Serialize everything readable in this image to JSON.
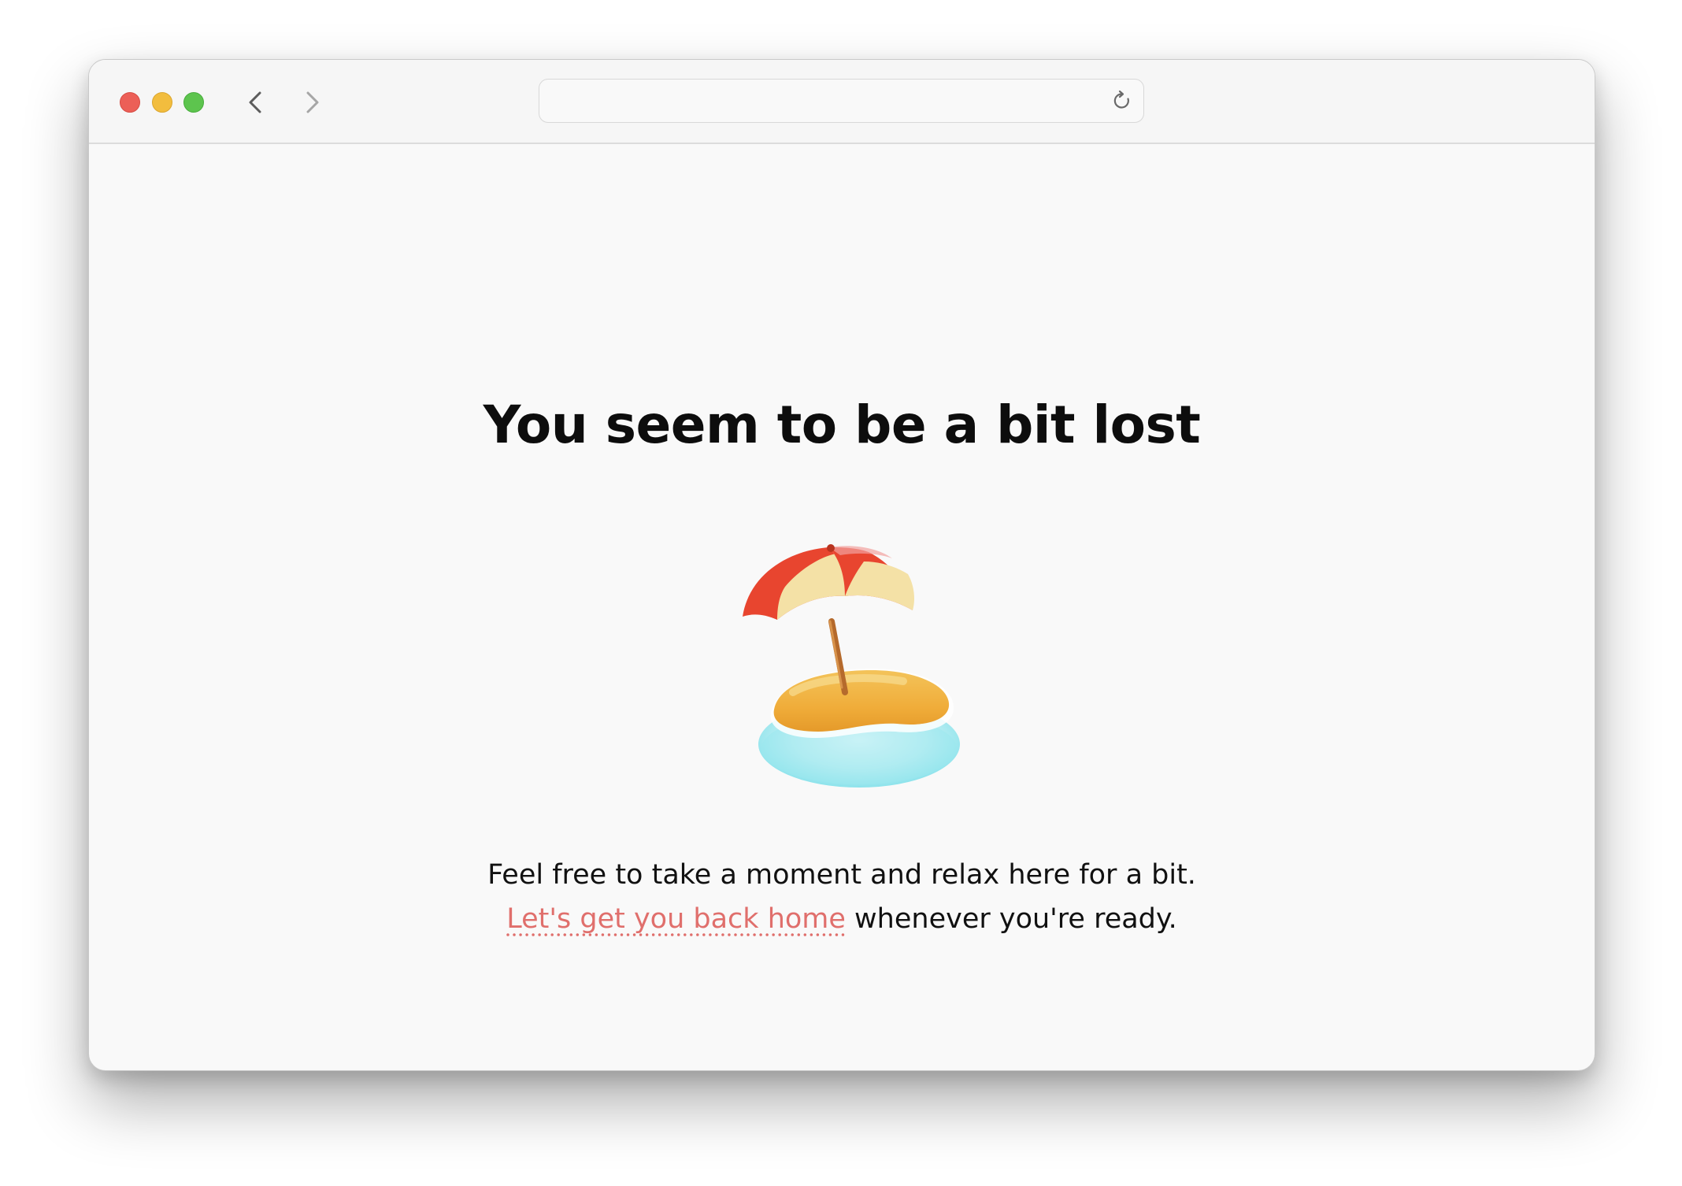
{
  "browser": {
    "address_text": "",
    "icons": {
      "back": "chevron-left-icon",
      "forward": "chevron-right-icon",
      "reload": "reload-icon"
    },
    "traffic_lights": {
      "close_color": "#ec5f57",
      "minimize_color": "#f2bd3e",
      "zoom_color": "#5dc44e"
    }
  },
  "page": {
    "heading": "You seem to be a bit lost",
    "illustration": "beach-umbrella-island-icon",
    "line1": "Feel free to take a moment and relax here for a bit.",
    "link_text": "Let's get you back home",
    "line2_rest": " whenever you're ready.",
    "link_color": "#e06f6c"
  }
}
